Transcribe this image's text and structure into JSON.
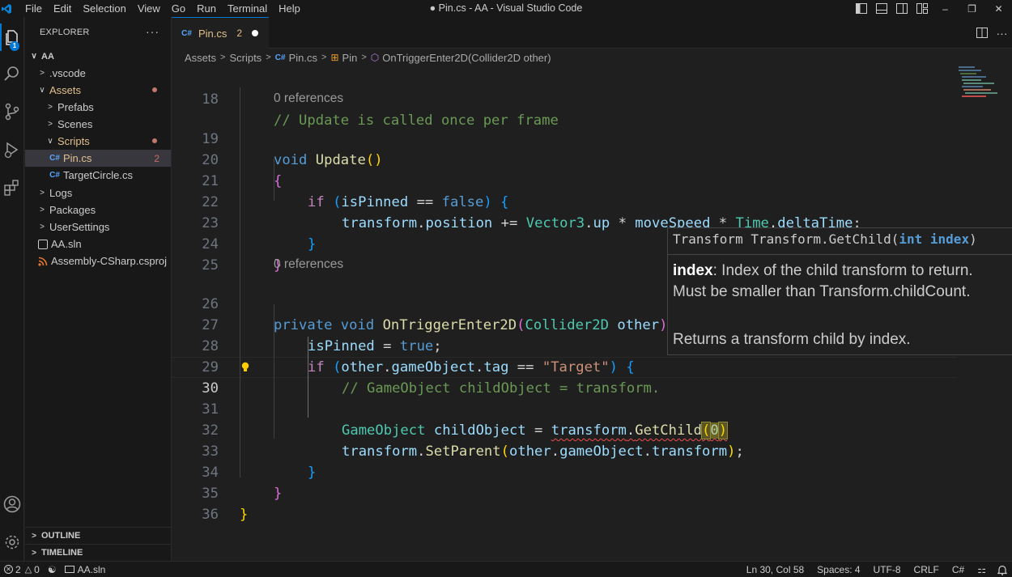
{
  "window": {
    "menu": [
      "File",
      "Edit",
      "Selection",
      "View",
      "Go",
      "Run",
      "Terminal",
      "Help"
    ],
    "title": "● Pin.cs - AA - Visual Studio Code"
  },
  "activity": {
    "explorer_badge": "1",
    "icons": [
      "files-icon",
      "search-icon",
      "source-control-icon",
      "run-debug-icon",
      "extensions-icon",
      "account-icon",
      "settings-gear-icon"
    ]
  },
  "sidebar": {
    "header": "EXPLORER",
    "more": "···",
    "root": "AA",
    "items": [
      {
        "label": ".vscode",
        "kind": "folder",
        "expanded": false
      },
      {
        "label": "Assets",
        "kind": "folder",
        "expanded": true,
        "modified": true
      },
      {
        "label": "Prefabs",
        "kind": "folder",
        "expanded": false
      },
      {
        "label": "Scenes",
        "kind": "folder",
        "expanded": false
      },
      {
        "label": "Scripts",
        "kind": "folder",
        "expanded": true,
        "modified": true
      },
      {
        "label": "Pin.cs",
        "kind": "cs",
        "modified": true,
        "count": "2",
        "selected": true
      },
      {
        "label": "TargetCircle.cs",
        "kind": "cs"
      },
      {
        "label": "Logs",
        "kind": "folder",
        "expanded": false
      },
      {
        "label": "Packages",
        "kind": "folder",
        "expanded": false
      },
      {
        "label": "UserSettings",
        "kind": "folder",
        "expanded": false
      },
      {
        "label": "AA.sln",
        "kind": "sln"
      },
      {
        "label": "Assembly-CSharp.csproj",
        "kind": "rss"
      }
    ],
    "sections": {
      "outline": "OUTLINE",
      "timeline": "TIMELINE"
    }
  },
  "tab": {
    "label": "Pin.cs",
    "count": "2"
  },
  "breadcrumb": [
    "Assets",
    "Scripts",
    "Pin.cs",
    "Pin",
    "OnTriggerEnter2D(Collider2D other)"
  ],
  "editor": {
    "lens1": "0 references",
    "lens2": "0 references",
    "line_numbers": [
      "18",
      "19",
      "20",
      "21",
      "22",
      "23",
      "24",
      "25",
      "26",
      "27",
      "28",
      "29",
      "30",
      "31",
      "32",
      "33",
      "34",
      "35",
      "36"
    ],
    "active_line": "30"
  },
  "hover": {
    "sig_prefix": "Transform Transform.GetChild(",
    "sig_type": "int",
    "sig_param": "index",
    "sig_suffix": ")",
    "param_name": "index",
    "param_desc1": ": Index of the child transform to return.",
    "param_desc2": "Must be smaller than Transform.childCount.",
    "returns": "Returns a transform child by index."
  },
  "status": {
    "errors": "2",
    "warnings": "0",
    "solution": "AA.sln",
    "position": "Ln 30, Col 58",
    "spaces": "Spaces: 4",
    "encoding": "UTF-8",
    "eol": "CRLF",
    "language": "C#"
  },
  "colors": {
    "accent": "#0078d4",
    "modified": "#e2c08d",
    "error": "#f14c4c"
  }
}
